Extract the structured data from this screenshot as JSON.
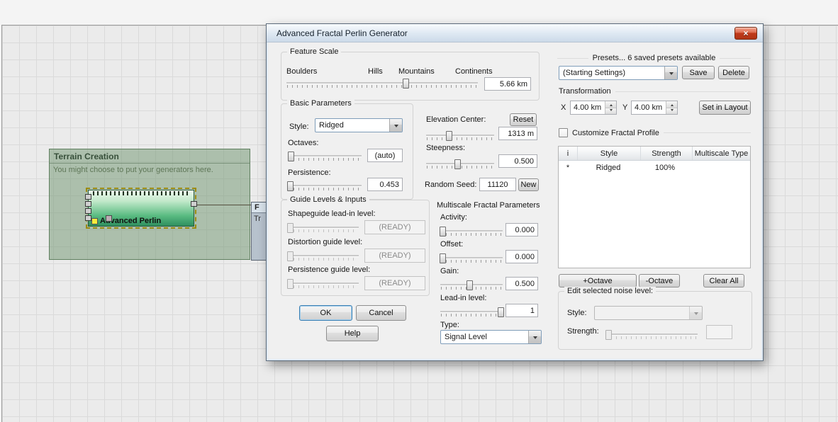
{
  "canvas": {
    "group": {
      "title": "Terrain Creation",
      "hint": "You might choose to put your generators here."
    },
    "node": {
      "label": "Advanced Perlin"
    },
    "hidden_node": {
      "line1": "F",
      "line2": "Tr"
    }
  },
  "dialog": {
    "title": "Advanced Fractal Perlin Generator",
    "feature_scale": {
      "legend": "Feature Scale",
      "tick_labels": [
        "Boulders",
        "Hills",
        "Mountains",
        "Continents"
      ],
      "value": "5.66 km"
    },
    "basic": {
      "legend": "Basic Parameters",
      "style_label": "Style:",
      "style_value": "Ridged",
      "octaves_label": "Octaves:",
      "octaves_value": "(auto)",
      "persistence_label": "Persistence:",
      "persistence_value": "0.453"
    },
    "elevation": {
      "center_label": "Elevation Center:",
      "reset_button": "Reset",
      "center_value": "1313 m",
      "steepness_label": "Steepness:",
      "steepness_value": "0.500",
      "seed_label": "Random Seed:",
      "seed_value": "11120",
      "new_button": "New"
    },
    "guides": {
      "legend": "Guide Levels & Inputs",
      "rows": [
        {
          "label": "Shapeguide lead-in level:",
          "value": "(READY)"
        },
        {
          "label": "Distortion guide level:",
          "value": "(READY)"
        },
        {
          "label": "Persistence guide level:",
          "value": "(READY)"
        }
      ]
    },
    "multiscale": {
      "legend": "Multiscale Fractal Parameters",
      "activity_label": "Activity:",
      "activity_value": "0.000",
      "offset_label": "Offset:",
      "offset_value": "0.000",
      "gain_label": "Gain:",
      "gain_value": "0.500",
      "leadin_label": "Lead-in level:",
      "leadin_value": "1",
      "type_label": "Type:",
      "type_value": "Signal Level"
    },
    "actions": {
      "ok": "OK",
      "cancel": "Cancel",
      "help": "Help"
    },
    "presets": {
      "legend": "Presets... 6 saved presets available",
      "selected": "(Starting Settings)",
      "save": "Save",
      "delete": "Delete"
    },
    "transform": {
      "legend": "Transformation",
      "x_label": "X",
      "x_value": "4.00 km",
      "y_label": "Y",
      "y_value": "4.00 km",
      "set_button": "Set in Layout"
    },
    "profile": {
      "checkbox_label": "Customize Fractal Profile",
      "headers": [
        "i",
        "Style",
        "Strength",
        "Multiscale Type"
      ],
      "row": [
        "*",
        "Ridged",
        "100%",
        ""
      ],
      "add_octave": "+Octave",
      "sub_octave": "-Octave",
      "clear_all": "Clear All",
      "edit_legend": "Edit selected noise level:",
      "edit_style_label": "Style:",
      "edit_strength_label": "Strength:"
    }
  }
}
